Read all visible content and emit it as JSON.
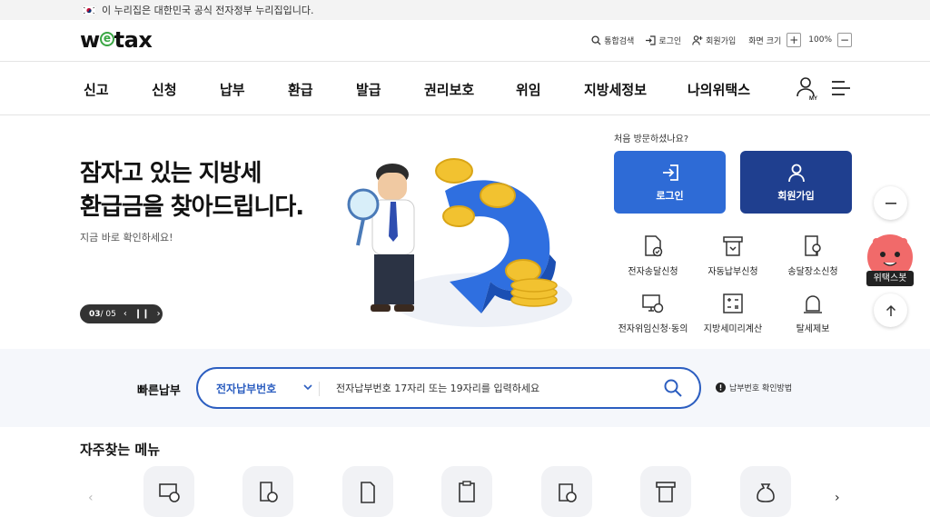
{
  "gov_bar": {
    "text": "이 누리집은 대한민국 공식 전자정부 누리집입니다."
  },
  "header": {
    "logo": "wetax",
    "search_label": "통합검색",
    "login_label": "로그인",
    "signup_label": "회원가입",
    "zoom_label": "화면 크기",
    "zoom_in": "+",
    "zoom_value": "100%",
    "zoom_out": "−"
  },
  "nav": {
    "items": [
      "신고",
      "신청",
      "납부",
      "환급",
      "발급",
      "권리보호",
      "위임",
      "지방세정보",
      "나의위택스"
    ],
    "my_label": "MY"
  },
  "hero": {
    "title_line1": "잠자고 있는 지방세",
    "title_line2": "환급금을 찾아드립니다.",
    "subtitle": "지금 바로 확인하세요!",
    "pager_current": "03",
    "pager_total": " / 05"
  },
  "member": {
    "first_visit": "처음 방문하셨나요?",
    "login_button": "로그인",
    "signup_button": "회원가입",
    "login_color": "#2e6bd6",
    "signup_color": "#1f3f8f"
  },
  "services": [
    {
      "label": "전자송달신청",
      "icon": "document-check-icon"
    },
    {
      "label": "자동납부신청",
      "icon": "auto-pay-icon"
    },
    {
      "label": "송달장소신청",
      "icon": "location-doc-icon"
    },
    {
      "label": "전자위임신청·동의",
      "icon": "delegate-icon"
    },
    {
      "label": "지방세미리계산",
      "icon": "calculator-icon"
    },
    {
      "label": "탈세제보",
      "icon": "alarm-bell-icon"
    }
  ],
  "floating": {
    "bot_label": "위택스봇"
  },
  "quick_pay": {
    "label": "빠른납부",
    "select_value": "전자납부번호",
    "placeholder": "전자납부번호 17자리 또는 19자리를 입력하세요",
    "help": "납부번호 확인방법",
    "accent": "#2c5ec0"
  },
  "favorites": {
    "title": "자주찾는 메뉴"
  }
}
